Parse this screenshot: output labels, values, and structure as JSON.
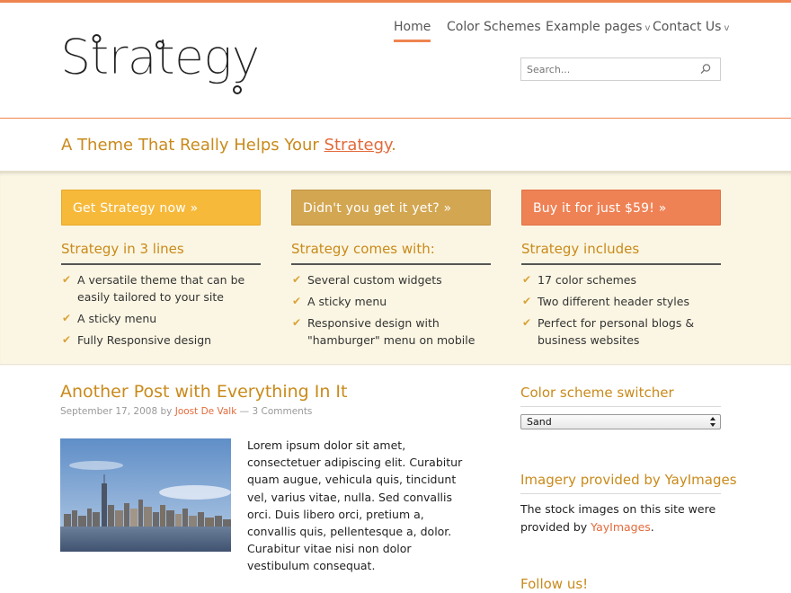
{
  "colors": {
    "accent": "#ef8450",
    "heading": "#c98a1b",
    "link": "#e36a3b",
    "band_bg": "#fbf6e3",
    "check": "#d9a33a"
  },
  "logo": {
    "text": "Strategy"
  },
  "nav": {
    "items": [
      {
        "label": "Home",
        "active": true,
        "dropdown": false
      },
      {
        "label": "Color Schemes",
        "active": false,
        "dropdown": false
      },
      {
        "label": "Example pages",
        "active": false,
        "dropdown": true
      },
      {
        "label": "Contact Us",
        "active": false,
        "dropdown": true
      }
    ]
  },
  "search": {
    "placeholder": "Search...",
    "icon": "search-icon"
  },
  "tagline": {
    "prefix": "A Theme That Really Helps Your ",
    "link": "Strategy",
    "suffix": "."
  },
  "features": [
    {
      "button": "Get Strategy now  »",
      "heading": "Strategy in 3 lines",
      "items": [
        "A versatile theme that can be easily tailored to your site",
        "A sticky menu",
        "Fully Responsive design"
      ]
    },
    {
      "button": "Didn't you get it yet?  »",
      "heading": "Strategy comes with:",
      "items": [
        "Several custom widgets",
        "A sticky menu",
        "Responsive design with \"hamburger\" menu on mobile"
      ]
    },
    {
      "button": "Buy it for just $59!  »",
      "heading": "Strategy includes",
      "items": [
        "17 color schemes",
        "Two different header styles",
        "Perfect for personal blogs & business websites"
      ]
    }
  ],
  "post": {
    "title": "Another Post with Everything In It",
    "date": "September 17, 2008",
    "by": "by",
    "author": "Joost De Valk",
    "separator": "—",
    "comments": "3 Comments",
    "body": "Lorem ipsum dolor sit amet, consectetuer adipiscing elit. Curabitur quam augue, vehicula quis, tincidunt vel, varius vitae, nulla. Sed convallis orci. Duis libero orci, pretium a, convallis quis, pellentesque a, dolor. Curabitur vitae nisi non dolor vestibulum consequat."
  },
  "sidebar": {
    "switcher_title": "Color scheme switcher",
    "switcher_value": "Sand",
    "imagery_title": "Imagery provided by YayImages",
    "imagery_text": "The stock images on this site were provided by ",
    "imagery_link": "YayImages",
    "imagery_end": ".",
    "follow_title": "Follow us!"
  }
}
